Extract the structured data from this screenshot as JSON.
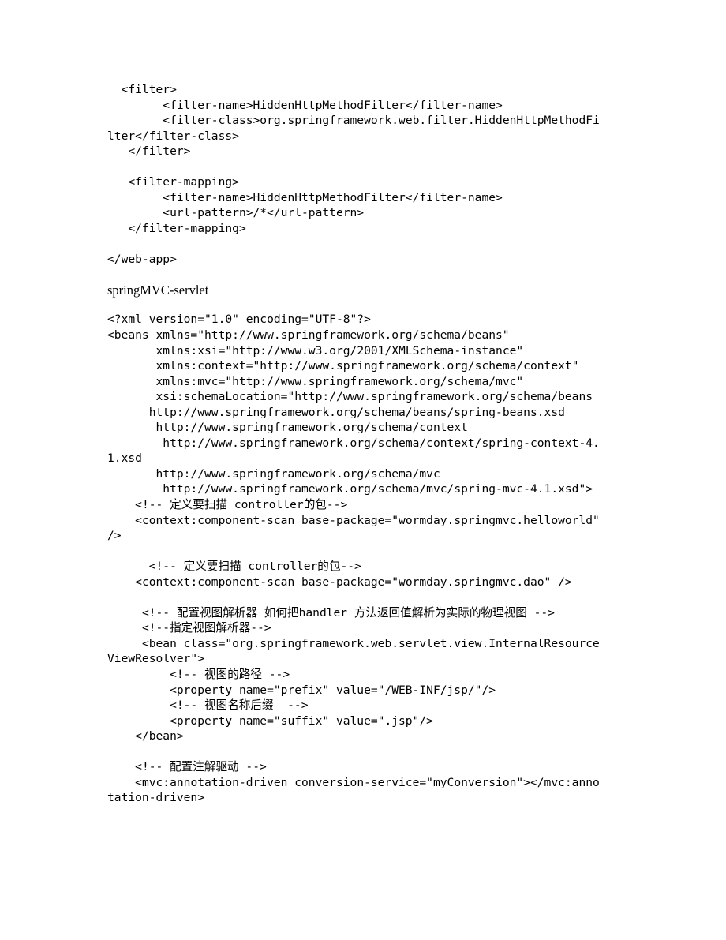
{
  "document": {
    "page_background": "#ffffff",
    "text_color": "#000000",
    "blocks": [
      {
        "id": "web_xml_filter",
        "kind": "code",
        "language": "xml",
        "text": "  <filter>\n        <filter-name>HiddenHttpMethodFilter</filter-name>\n        <filter-class>org.springframework.web.filter.HiddenHttpMethodFilter</filter-class>\n   </filter>"
      },
      {
        "id": "web_xml_filter_mapping",
        "kind": "code",
        "language": "xml",
        "text": "   <filter-mapping>\n        <filter-name>HiddenHttpMethodFilter</filter-name>\n        <url-pattern>/*</url-pattern>\n   </filter-mapping>"
      },
      {
        "id": "web_app_close",
        "kind": "code",
        "language": "xml",
        "text": "</web-app>"
      },
      {
        "id": "springmvc_servlet_heading",
        "kind": "heading",
        "text": "springMVC-servlet"
      },
      {
        "id": "springmvc_servlet_xml",
        "kind": "code",
        "language": "xml",
        "text": "<?xml version=\"1.0\" encoding=\"UTF-8\"?>\n<beans xmlns=\"http://www.springframework.org/schema/beans\"\n       xmlns:xsi=\"http://www.w3.org/2001/XMLSchema-instance\"\n       xmlns:context=\"http://www.springframework.org/schema/context\"\n       xmlns:mvc=\"http://www.springframework.org/schema/mvc\"\n       xsi:schemaLocation=\"http://www.springframework.org/schema/beans\n      http://www.springframework.org/schema/beans/spring-beans.xsd\n       http://www.springframework.org/schema/context\n        http://www.springframework.org/schema/context/spring-context-4.1.xsd\n       http://www.springframework.org/schema/mvc\n        http://www.springframework.org/schema/mvc/spring-mvc-4.1.xsd\">\n    <!-- 定义要扫描 controller的包-->\n    <context:component-scan base-package=\"wormday.springmvc.helloworld\" />"
      },
      {
        "id": "springmvc_dao_scan",
        "kind": "code",
        "language": "xml",
        "text": "      <!-- 定义要扫描 controller的包-->\n    <context:component-scan base-package=\"wormday.springmvc.dao\" />"
      },
      {
        "id": "springmvc_view_resolver",
        "kind": "code",
        "language": "xml",
        "text": "     <!-- 配置视图解析器 如何把handler 方法返回值解析为实际的物理视图 -->\n     <!--指定视图解析器-->\n     <bean class=\"org.springframework.web.servlet.view.InternalResourceViewResolver\">\n         <!-- 视图的路径 -->\n         <property name=\"prefix\" value=\"/WEB-INF/jsp/\"/>\n         <!-- 视图名称后缀  -->\n         <property name=\"suffix\" value=\".jsp\"/>\n    </bean>"
      },
      {
        "id": "springmvc_annotation_driven",
        "kind": "code",
        "language": "xml",
        "text": "    <!-- 配置注解驱动 -->\n    <mvc:annotation-driven conversion-service=\"myConversion\"></mvc:annotation-driven>"
      }
    ]
  }
}
